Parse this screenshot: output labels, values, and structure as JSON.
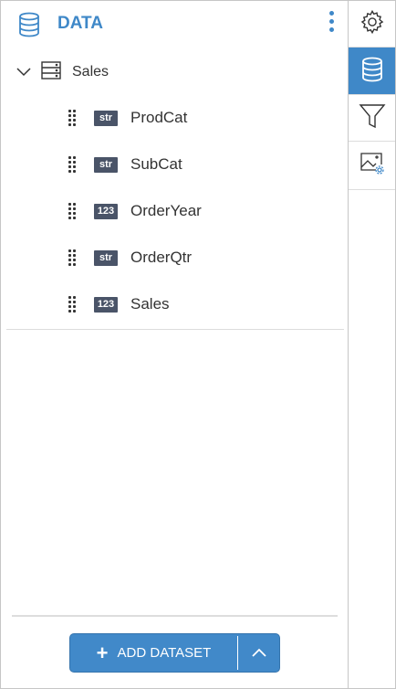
{
  "header": {
    "title": "DATA",
    "icon": "database-icon",
    "menu_icon": "more-vertical-icon"
  },
  "dataset": {
    "name": "Sales",
    "expanded": true,
    "fields": [
      {
        "type": "str",
        "name": "ProdCat"
      },
      {
        "type": "str",
        "name": "SubCat"
      },
      {
        "type": "123",
        "name": "OrderYear"
      },
      {
        "type": "str",
        "name": "OrderQtr"
      },
      {
        "type": "123",
        "name": "Sales"
      }
    ]
  },
  "footer": {
    "add_label": "ADD DATASET"
  },
  "sidebar": {
    "tabs": [
      {
        "icon": "gear-icon",
        "active": false
      },
      {
        "icon": "database-icon",
        "active": true
      },
      {
        "icon": "filter-icon",
        "active": false
      },
      {
        "icon": "image-settings-icon",
        "active": false
      }
    ]
  },
  "colors": {
    "accent": "#3f88c8",
    "badge": "#4a5468"
  }
}
